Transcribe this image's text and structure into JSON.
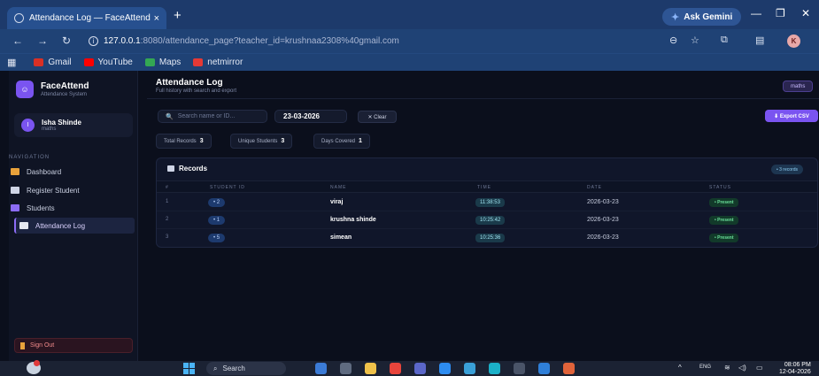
{
  "browser": {
    "tab_title": "Attendance Log — FaceAttend",
    "tab_close": "×",
    "new_tab": "+",
    "gemini_label": "Ask Gemini",
    "url_host": "127.0.0.1",
    "url_path": ":8080/attendance_page?teacher_id=krushnaa2308%40gmail.com",
    "profile_initial": "K",
    "bookmarks": [
      {
        "label": "Gmail",
        "color": "#d93025"
      },
      {
        "label": "YouTube",
        "color": "#ff0000"
      },
      {
        "label": "Maps",
        "color": "#34a853"
      },
      {
        "label": "netmirror",
        "color": "#e53935"
      }
    ]
  },
  "sidebar": {
    "brand_title": "FaceAttend",
    "brand_sub": "Attendance System",
    "user_initial": "I",
    "user_name": "Isha Shinde",
    "user_sub": "maths",
    "nav_heading": "NAVIGATION",
    "items": [
      {
        "label": "Dashboard",
        "color": "#e9a23b"
      },
      {
        "label": "Register Student",
        "color": "#cfd5e6"
      },
      {
        "label": "Students",
        "color": "#8c6cf5"
      },
      {
        "label": "Attendance Log",
        "color": "#e6e8f0"
      }
    ],
    "sign_out": "Sign Out"
  },
  "header": {
    "title": "Attendance Log",
    "subtitle": "Full history with search and export",
    "subject_badge": "maths"
  },
  "filters": {
    "search_placeholder": "Search name or ID...",
    "date_value": "23-03-2026",
    "clear_label": "✕ Clear",
    "export_label": "⬇ Export CSV"
  },
  "stats": [
    {
      "label": "Total Records",
      "value": "3"
    },
    {
      "label": "Unique Students",
      "value": "3"
    },
    {
      "label": "Days Covered",
      "value": "1"
    }
  ],
  "records": {
    "title": "Records",
    "count_badge": "• 3 records",
    "columns": [
      "#",
      "STUDENT ID",
      "NAME",
      "TIME",
      "DATE",
      "STATUS"
    ],
    "rows": [
      {
        "idx": "1",
        "id": "• 2",
        "name": "viraj",
        "time": "11:38:53",
        "date": "2026-03-23",
        "status": "• Present"
      },
      {
        "idx": "2",
        "id": "• 1",
        "name": "krushna shinde",
        "time": "10:25:42",
        "date": "2026-03-23",
        "status": "• Present"
      },
      {
        "idx": "3",
        "id": "• 5",
        "name": "simean",
        "time": "10:25:36",
        "date": "2026-03-23",
        "status": "• Present"
      }
    ]
  },
  "taskbar": {
    "search_label": "Search",
    "lang": "ENG",
    "time": "08:06 PM",
    "date": "12-04-2026"
  }
}
